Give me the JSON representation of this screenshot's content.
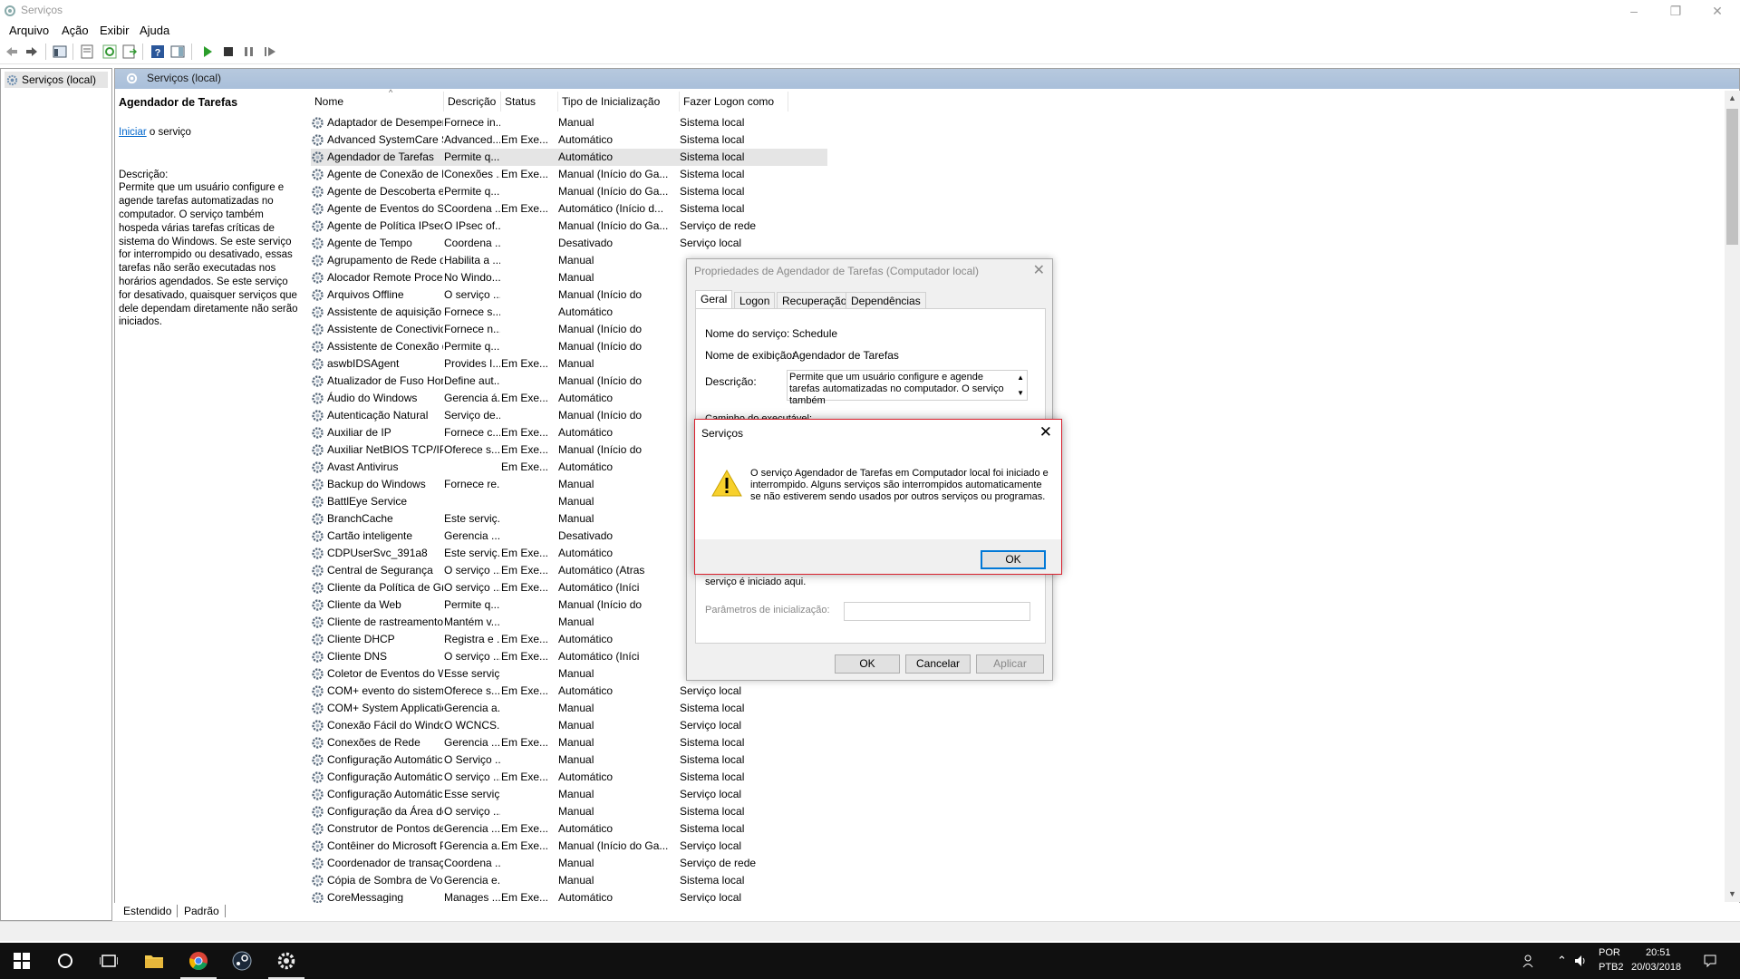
{
  "window": {
    "title": "Serviços"
  },
  "menu": [
    "Arquivo",
    "Ação",
    "Exibir",
    "Ajuda"
  ],
  "tree": {
    "root": "Serviços (local)"
  },
  "main_header": "Serviços (local)",
  "details": {
    "service_name": "Agendador de Tarefas",
    "start_link": "Iniciar",
    "start_suffix": " o serviço",
    "desc_label": "Descrição:",
    "desc_text": "Permite que um usuário configure e agende tarefas automatizadas no computador. O serviço também hospeda várias tarefas críticas de sistema do Windows. Se este serviço for interrompido ou desativado, essas tarefas não serão executadas nos horários agendados. Se este serviço for desativado, quaisquer serviços que dele dependam diretamente não serão iniciados."
  },
  "columns": [
    "Nome",
    "Descrição",
    "Status",
    "Tipo de Inicialização",
    "Fazer Logon como"
  ],
  "rows": [
    [
      "Adaptador de Desempenho...",
      "Fornece in...",
      "",
      "Manual",
      "Sistema local"
    ],
    [
      "Advanced SystemCare Servi...",
      "Advanced...",
      "Em Exe...",
      "Automático",
      "Sistema local"
    ],
    [
      "Agendador de Tarefas",
      "Permite q...",
      "",
      "Automático",
      "Sistema local"
    ],
    [
      "Agente de Conexão de Rede",
      "Conexões ...",
      "Em Exe...",
      "Manual (Início do Ga...",
      "Sistema local"
    ],
    [
      "Agente de Descoberta em S...",
      "Permite q...",
      "",
      "Manual (Início do Ga...",
      "Sistema local"
    ],
    [
      "Agente de Eventos do Siste...",
      "Coordena ...",
      "Em Exe...",
      "Automático (Início d...",
      "Sistema local"
    ],
    [
      "Agente de Política IPsec",
      "O IPsec of...",
      "",
      "Manual (Início do Ga...",
      "Serviço de rede"
    ],
    [
      "Agente de Tempo",
      "Coordena ...",
      "",
      "Desativado",
      "Serviço local"
    ],
    [
      "Agrupamento de Rede de Par",
      "Habilita a ...",
      "",
      "Manual",
      ""
    ],
    [
      "Alocador Remote Procedur...",
      "No Windo...",
      "",
      "Manual",
      ""
    ],
    [
      "Arquivos Offline",
      "O serviço ...",
      "",
      "Manual (Início do",
      ""
    ],
    [
      "Assistente de aquisição de i...",
      "Fornece s...",
      "",
      "Automático",
      ""
    ],
    [
      "Assistente de Conectividad...",
      "Fornece n...",
      "",
      "Manual (Início do",
      ""
    ],
    [
      "Assistente de Conexão de C...",
      "Permite q...",
      "",
      "Manual (Início do",
      ""
    ],
    [
      "aswbIDSAgent",
      "Provides I...",
      "Em Exe...",
      "Manual",
      ""
    ],
    [
      "Atualizador de Fuso Horário...",
      "Define aut...",
      "",
      "Manual (Início do",
      ""
    ],
    [
      "Áudio do Windows",
      "Gerencia á...",
      "Em Exe...",
      "Automático",
      ""
    ],
    [
      "Autenticação Natural",
      "Serviço de...",
      "",
      "Manual (Início do",
      ""
    ],
    [
      "Auxiliar de IP",
      "Fornece c...",
      "Em Exe...",
      "Automático",
      ""
    ],
    [
      "Auxiliar NetBIOS TCP/IP",
      "Oferece s...",
      "Em Exe...",
      "Manual (Início do",
      ""
    ],
    [
      "Avast Antivirus",
      "",
      "Em Exe...",
      "Automático",
      ""
    ],
    [
      "Backup do Windows",
      "Fornece re...",
      "",
      "Manual",
      ""
    ],
    [
      "BattlEye Service",
      "",
      "",
      "Manual",
      ""
    ],
    [
      "BranchCache",
      "Este serviç...",
      "",
      "Manual",
      ""
    ],
    [
      "Cartão inteligente",
      "Gerencia ...",
      "",
      "Desativado",
      ""
    ],
    [
      "CDPUserSvc_391a8",
      "Este serviç...",
      "Em Exe...",
      "Automático",
      ""
    ],
    [
      "Central de Segurança",
      "O serviço ...",
      "Em Exe...",
      "Automático (Atras",
      ""
    ],
    [
      "Cliente da Política de Grupo",
      "O serviço ...",
      "Em Exe...",
      "Automático (Iníci",
      ""
    ],
    [
      "Cliente da Web",
      "Permite q...",
      "",
      "Manual (Início do",
      ""
    ],
    [
      "Cliente de rastreamento de ...",
      "Mantém v...",
      "",
      "Manual",
      ""
    ],
    [
      "Cliente DHCP",
      "Registra e ...",
      "Em Exe...",
      "Automático",
      ""
    ],
    [
      "Cliente DNS",
      "O serviço ...",
      "Em Exe...",
      "Automático (Iníci",
      ""
    ],
    [
      "Coletor de Eventos do Wind...",
      "Esse serviç...",
      "",
      "Manual",
      ""
    ],
    [
      "COM+ evento do sistema",
      "Oferece s...",
      "Em Exe...",
      "Automático",
      "Serviço local"
    ],
    [
      "COM+ System Application",
      "Gerencia a...",
      "",
      "Manual",
      "Sistema local"
    ],
    [
      "Conexão Fácil do Windows ...",
      "O WCNCS...",
      "",
      "Manual",
      "Serviço local"
    ],
    [
      "Conexões de Rede",
      "Gerencia ...",
      "Em Exe...",
      "Manual",
      "Sistema local"
    ],
    [
      "Configuração Automática c...",
      "O Serviço ...",
      "",
      "Manual",
      "Sistema local"
    ],
    [
      "Configuração Automática d...",
      "O serviço ...",
      "Em Exe...",
      "Automático",
      "Sistema local"
    ],
    [
      "Configuração Automática d...",
      "Esse serviç...",
      "",
      "Manual",
      "Serviço local"
    ],
    [
      "Configuração da Área de Tr...",
      "O serviço ...",
      "",
      "Manual",
      "Sistema local"
    ],
    [
      "Construtor de Pontos de Ext...",
      "Gerencia ...",
      "Em Exe...",
      "Automático",
      "Sistema local"
    ],
    [
      "Contêiner do Microsoft Pas...",
      "Gerencia a...",
      "Em Exe...",
      "Manual (Início do Ga...",
      "Serviço local"
    ],
    [
      "Coordenador de transações...",
      "Coordena ...",
      "",
      "Manual",
      "Serviço de rede"
    ],
    [
      "Cópia de Sombra de Volume",
      "Gerencia e...",
      "",
      "Manual",
      "Sistema local"
    ],
    [
      "CoreMessaging",
      "Manages ...",
      "Em Exe...",
      "Automático",
      "Serviço local"
    ]
  ],
  "bottom_tabs": [
    "Estendido",
    "Padrão"
  ],
  "props": {
    "title": "Propriedades de Agendador de Tarefas (Computador local)",
    "tabs": [
      "Geral",
      "Logon",
      "Recuperação",
      "Dependências"
    ],
    "service_name_label": "Nome do serviço:",
    "service_name_value": "Schedule",
    "display_name_label": "Nome de exibição:",
    "display_name_value": "Agendador de Tarefas",
    "desc_label": "Descrição:",
    "desc_value": "Permite que um usuário configure e agende tarefas automatizadas no computador. O serviço também",
    "partial_label": "Caminho do executável:",
    "hint": "serviço é iniciado aqui.",
    "params_label": "Parâmetros de inicialização:",
    "ok": "OK",
    "cancel": "Cancelar",
    "apply": "Aplicar"
  },
  "msgbox": {
    "title": "Serviços",
    "text": "O serviço Agendador de Tarefas em Computador local foi iniciado e interrompido. Alguns serviços são interrompidos automaticamente se não estiverem sendo usados por outros serviços ou programas.",
    "ok": "OK"
  },
  "tray": {
    "lang1": "POR",
    "lang2": "PTB2",
    "time": "20:51",
    "date": "20/03/2018"
  }
}
